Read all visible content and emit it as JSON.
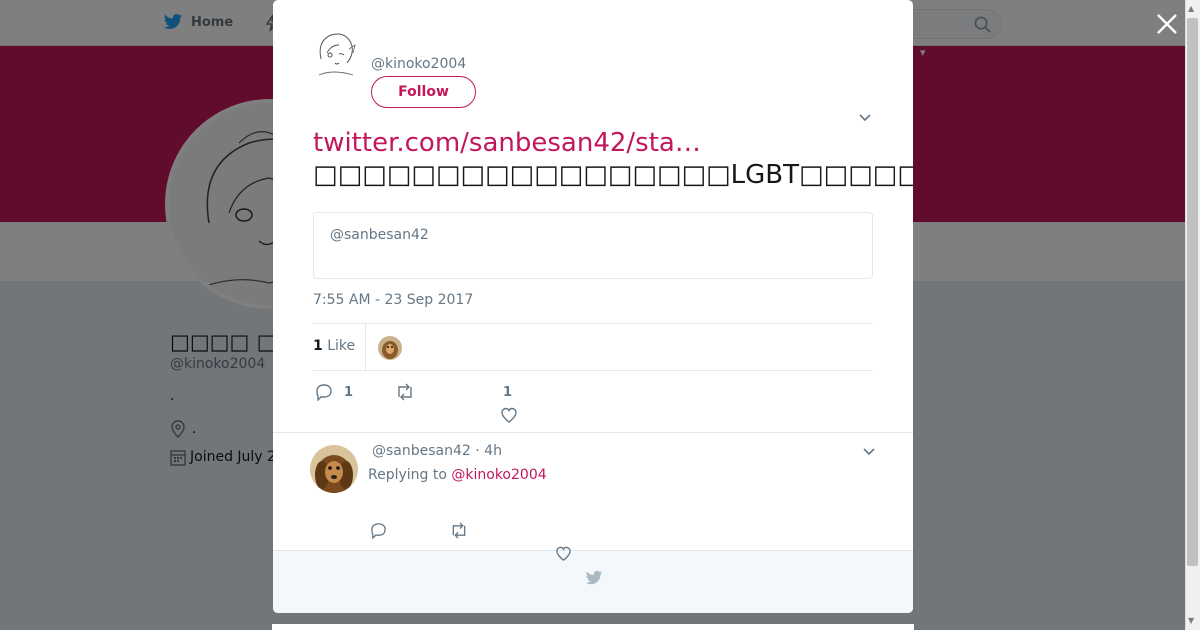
{
  "background_page": {
    "nav": {
      "home_label": "Home"
    },
    "banner_menu_label": "▾",
    "profile": {
      "name": "□□□□ □□□□",
      "handle": "@kinoko2004",
      "bio": ".",
      "location": ".",
      "joined": "Joined July 2"
    }
  },
  "modal": {
    "author_handle": "@kinoko2004",
    "follow_label": "Follow",
    "tweet_link": "twitter.com/sanbesan42/sta…",
    "tweet_text": "□□□□□□□□□□□□□□□□□LGBT□□□□□□□□□□□□□□□□□□□□□□□□□□□□□□□□□",
    "quote_handle": "@sanbesan42",
    "timestamp": "7:55 AM - 23 Sep 2017",
    "likes": {
      "count": "1",
      "label": "Like"
    },
    "actions": {
      "reply_count": "1",
      "like_count": "1"
    },
    "reply": {
      "meta": "@sanbesan42 · 4h",
      "replying_prefix": "Replying to ",
      "replying_to": "@kinoko2004"
    }
  },
  "icons": {
    "close": "close-icon",
    "twitter": "twitter-bird-icon",
    "reply": "reply-icon",
    "retweet": "retweet-icon",
    "like": "heart-icon",
    "search": "search-icon",
    "caret": "chevron-down-icon"
  },
  "colors": {
    "accent": "#c2185b",
    "twitter_blue": "#1da1f2",
    "muted": "#657786"
  }
}
